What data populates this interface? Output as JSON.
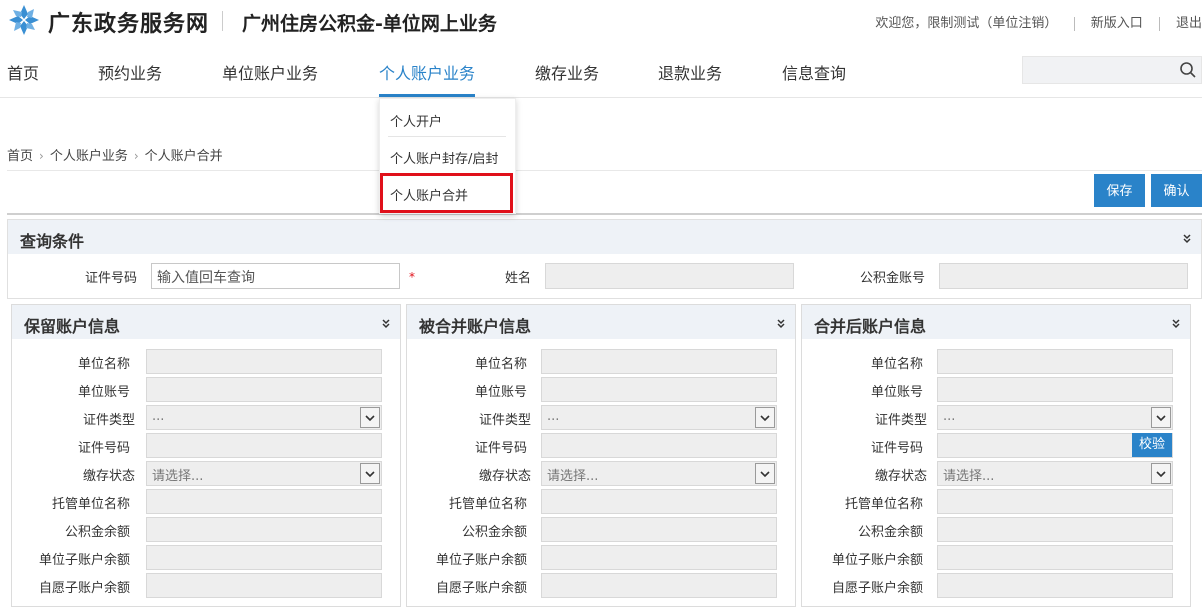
{
  "header": {
    "brand": "广东政务服务网",
    "subtitle": "广州住房公积金-单位网上业务",
    "welcome": "欢迎您，限制测试（单位注销）",
    "new_entry": "新版入口",
    "logout": "退出"
  },
  "nav": {
    "items": [
      "首页",
      "预约业务",
      "单位账户业务",
      "个人账户业务",
      "缴存业务",
      "退款业务",
      "信息查询"
    ],
    "active": "个人账户业务",
    "accent": "#2a83c9"
  },
  "dropdown": {
    "items": [
      "个人开户",
      "个人账户封存/启封",
      "个人账户合并"
    ],
    "highlighted": "个人账户合并",
    "highlight_color": "#e0101a"
  },
  "breadcrumb": [
    "首页",
    "个人账户业务",
    "个人账户合并"
  ],
  "actions": {
    "save": "保存",
    "confirm": "确认"
  },
  "query": {
    "title": "查询条件",
    "id_label": "证件号码",
    "id_placeholder": "输入值回车查询",
    "required_mark": "*",
    "name_label": "姓名",
    "fund_label": "公积金账号"
  },
  "panels": [
    {
      "title": "保留账户信息",
      "fields": [
        "单位名称",
        "单位账号",
        "证件类型",
        "证件号码",
        "缴存状态",
        "托管单位名称",
        "公积金余额",
        "单位子账户余额",
        "自愿子账户余额"
      ],
      "cert_type_value": "...",
      "status_value": "请选择..."
    },
    {
      "title": "被合并账户信息",
      "fields": [
        "单位名称",
        "单位账号",
        "证件类型",
        "证件号码",
        "缴存状态",
        "托管单位名称",
        "公积金余额",
        "单位子账户余额",
        "自愿子账户余额"
      ],
      "cert_type_value": "...",
      "status_value": "请选择..."
    },
    {
      "title": "合并后账户信息",
      "fields": [
        "单位名称",
        "单位账号",
        "证件类型",
        "证件号码",
        "缴存状态",
        "托管单位名称",
        "公积金余额",
        "单位子账户余额",
        "自愿子账户余额"
      ],
      "cert_type_value": "...",
      "status_value": "请选择...",
      "verify_label": "校验"
    }
  ]
}
